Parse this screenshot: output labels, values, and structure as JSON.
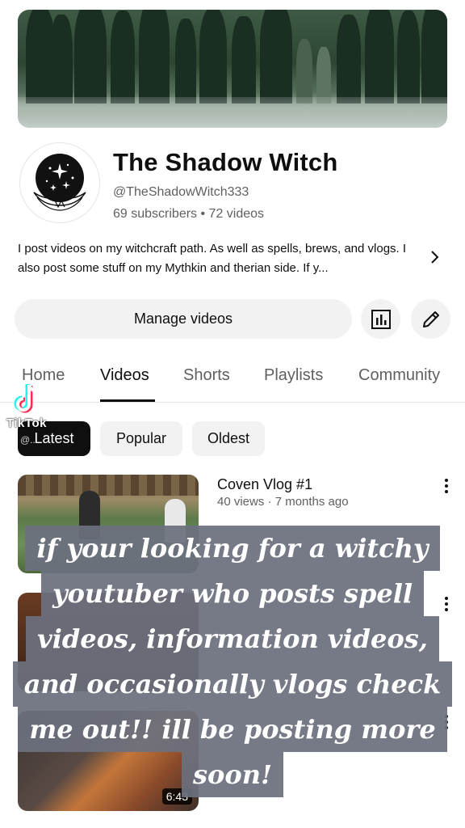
{
  "channel": {
    "name": "The Shadow Witch",
    "handle": "@TheShadowWitch333",
    "stats": "69 subscribers • 72 videos",
    "description": "I post videos on my witchcraft path. As well as spells, brews, and vlogs. I also post some stuff on my Mythkin and therian side. If y..."
  },
  "actions": {
    "manage_label": "Manage videos",
    "analytics_icon": "analytics-icon",
    "edit_icon": "pencil-icon"
  },
  "tabs": [
    {
      "label": "Home"
    },
    {
      "label": "Videos"
    },
    {
      "label": "Shorts"
    },
    {
      "label": "Playlists"
    },
    {
      "label": "Community"
    }
  ],
  "active_tab": "Videos",
  "filters": [
    {
      "label": "Latest"
    },
    {
      "label": "Popular"
    },
    {
      "label": "Oldest"
    }
  ],
  "active_filter": "Latest",
  "videos": [
    {
      "title": "Coven Vlog #1",
      "meta": "40 views · 7 months ago",
      "duration": ""
    },
    {
      "title": "",
      "meta": "",
      "duration": ""
    },
    {
      "title": "",
      "meta": "",
      "duration": "6:43"
    }
  ],
  "watermark": {
    "brand": "TikTok",
    "user": "@..."
  },
  "overlay": {
    "lines": [
      "if your looking for a witchy",
      "youtuber who posts spell",
      "videos, information videos,",
      "and occasionally vlogs check",
      "me out!! ill be posting more",
      "soon!"
    ]
  },
  "colors": {
    "text_primary": "#0f0f0f",
    "text_secondary": "#606060",
    "chip_bg": "#f2f2f2",
    "overlay_bg": "#6c707e"
  }
}
